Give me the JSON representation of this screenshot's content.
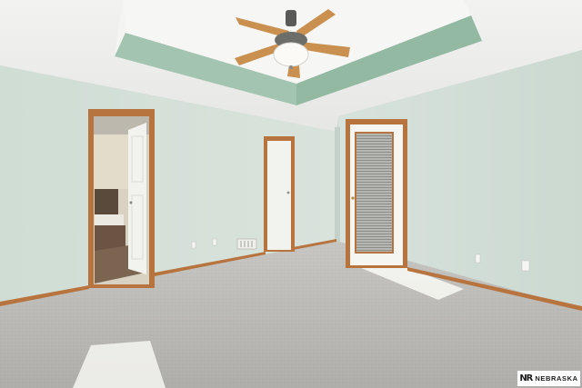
{
  "scene": {
    "description_items": [
      "ceiling-fan",
      "tray-ceiling",
      "bathroom-doorway",
      "closet-door",
      "patio-door-with-blinds",
      "carpet",
      "floor-vent",
      "outlets"
    ]
  },
  "watermark": {
    "logo": "NR",
    "text": "NEBRASKA"
  },
  "colors": {
    "wall": "#d5e0da",
    "wall_shadow": "#c3d0c9",
    "ceiling": "#eeeeec",
    "tray_band": "#9fc2ad",
    "trim_wood": "#b8743f",
    "carpet": "#b9b8b4",
    "door_white": "#f2f2ef",
    "fan_blade": "#c99050"
  }
}
